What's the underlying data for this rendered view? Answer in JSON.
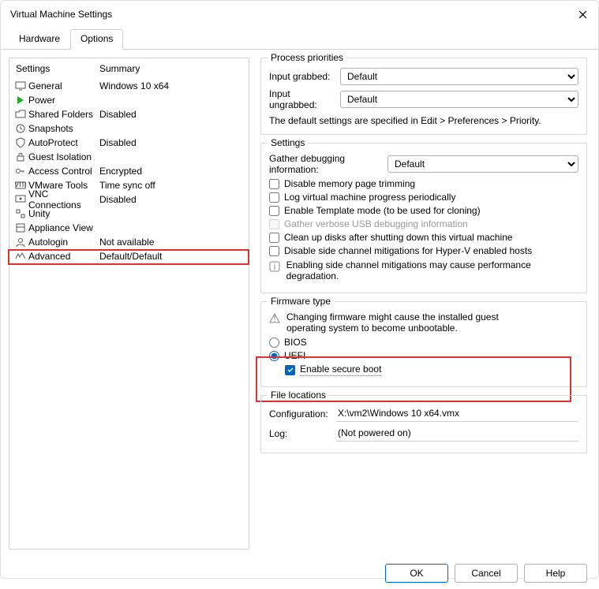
{
  "window": {
    "title": "Virtual Machine Settings"
  },
  "tabs": {
    "hardware": "Hardware",
    "options": "Options"
  },
  "settings_header": {
    "col1": "Settings",
    "col2": "Summary"
  },
  "settings_rows": [
    {
      "icon": "monitor",
      "label": "General",
      "summary": "Windows 10 x64"
    },
    {
      "icon": "play",
      "label": "Power",
      "summary": ""
    },
    {
      "icon": "folder",
      "label": "Shared Folders",
      "summary": "Disabled"
    },
    {
      "icon": "clock",
      "label": "Snapshots",
      "summary": ""
    },
    {
      "icon": "shield",
      "label": "AutoProtect",
      "summary": "Disabled"
    },
    {
      "icon": "lock",
      "label": "Guest Isolation",
      "summary": ""
    },
    {
      "icon": "key",
      "label": "Access Control",
      "summary": "Encrypted"
    },
    {
      "icon": "vm",
      "label": "VMware Tools",
      "summary": "Time sync off"
    },
    {
      "icon": "vnc",
      "label": "VNC Connections",
      "summary": "Disabled"
    },
    {
      "icon": "unity",
      "label": "Unity",
      "summary": ""
    },
    {
      "icon": "appliance",
      "label": "Appliance View",
      "summary": ""
    },
    {
      "icon": "user",
      "label": "Autologin",
      "summary": "Not available"
    },
    {
      "icon": "advanced",
      "label": "Advanced",
      "summary": "Default/Default"
    }
  ],
  "priorities": {
    "legend": "Process priorities",
    "grabbed_lbl": "Input grabbed:",
    "ungrabbed_lbl": "Input ungrabbed:",
    "grabbed_val": "Default",
    "ungrabbed_val": "Default",
    "info": "The default settings are specified in Edit > Preferences > Priority."
  },
  "settings_group": {
    "legend": "Settings",
    "debug_lbl": "Gather debugging information:",
    "debug_val": "Default",
    "cb1": "Disable memory page trimming",
    "cb2": "Log virtual machine progress periodically",
    "cb3": "Enable Template mode (to be used for cloning)",
    "cb4": "Gather verbose USB debugging information",
    "cb5": "Clean up disks after shutting down this virtual machine",
    "cb6": "Disable side channel mitigations for Hyper-V enabled hosts",
    "warn": "Enabling side channel mitigations may cause performance degradation."
  },
  "firmware": {
    "legend": "Firmware type",
    "warn": "Changing firmware might cause the installed guest operating system to become unbootable.",
    "bios": "BIOS",
    "uefi": "UEFI",
    "secure_boot": "Enable secure boot"
  },
  "fileloc": {
    "legend": "File locations",
    "config_lbl": "Configuration:",
    "config_val": "X:\\vm2\\Windows 10 x64.vmx",
    "log_lbl": "Log:",
    "log_val": "(Not powered on)"
  },
  "buttons": {
    "ok": "OK",
    "cancel": "Cancel",
    "help": "Help"
  }
}
